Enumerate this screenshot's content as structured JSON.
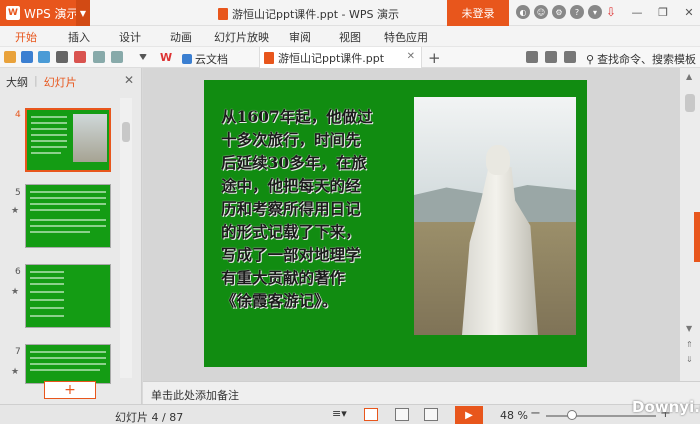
{
  "titlebar": {
    "app_name": "WPS 演示",
    "doc_title": "游恒山记ppt课件.ppt - WPS 演示",
    "login_label": "未登录"
  },
  "menu": {
    "items": [
      "开始",
      "插入",
      "设计",
      "动画",
      "幻灯片放映",
      "审阅",
      "视图",
      "特色应用"
    ]
  },
  "toolbar": {
    "ws_label": "W",
    "cloud_label": "云文档",
    "file_tab": "游恒山记ppt课件.ppt",
    "search_label": "查找命令、搜索模板"
  },
  "leftpanel": {
    "tab_outline": "大纲",
    "tab_slides": "幻灯片",
    "thumb_numbers": [
      "4",
      "5",
      "6",
      "7"
    ]
  },
  "slide": {
    "text_lines": [
      "从1607年起，他做过",
      "十多次旅行，时间先",
      "后延续30多年，在旅",
      "途中，他把每天的经",
      "历和考察所得用日记",
      "的形式记载了下来，",
      "写成了一部对地理学",
      "有重大贡献的著作",
      "《徐霞客游记》。"
    ]
  },
  "notes": {
    "placeholder": "单击此处添加备注"
  },
  "status": {
    "slide_count": "幻灯片 4 / 87",
    "zoom": "48 %"
  },
  "watermark": "Downyi.com",
  "colors": {
    "accent": "#e8561c",
    "slide_bg": "#118c11"
  }
}
